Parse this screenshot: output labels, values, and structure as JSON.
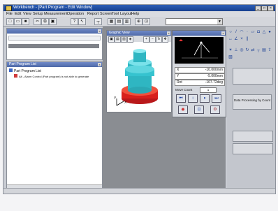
{
  "window": {
    "title": "Workbench - [Part Program - Edit Window]",
    "min_icon": "minimize-icon",
    "max_icon": "maximize-icon",
    "close_icon": "close-icon"
  },
  "menu": [
    "File",
    "Edit",
    "View",
    "Setup",
    "Measurement",
    "Operation",
    "Report Screen",
    "Tool",
    "Layout",
    "Help"
  ],
  "toolbar": {
    "combo_value": ""
  },
  "panels": {
    "top_left": {
      "title": ""
    },
    "tree": {
      "title": "Part Program List",
      "root_label": "Part Program List",
      "child_label": "Alt - Alarm Control (Part program) is not able to generate"
    },
    "viewport": {
      "title": "Graphic View",
      "axis_x": "X",
      "axis_y": "Y"
    },
    "readout": {
      "rows": [
        {
          "key": "X",
          "value": "-10.000mm"
        },
        {
          "key": "Y",
          "value": "-5.000mm"
        },
        {
          "key": "Rot",
          "value": "-107.72deg"
        }
      ],
      "move_label": "Move Count",
      "move_value": "1"
    }
  },
  "right_panel": {
    "button_label": "Data Processing by Count"
  },
  "colors": {
    "title_bar": "#1f4fa6",
    "cylinder": "#2fb6c2",
    "base": "#d8201c",
    "readout_bg": "#000000"
  }
}
